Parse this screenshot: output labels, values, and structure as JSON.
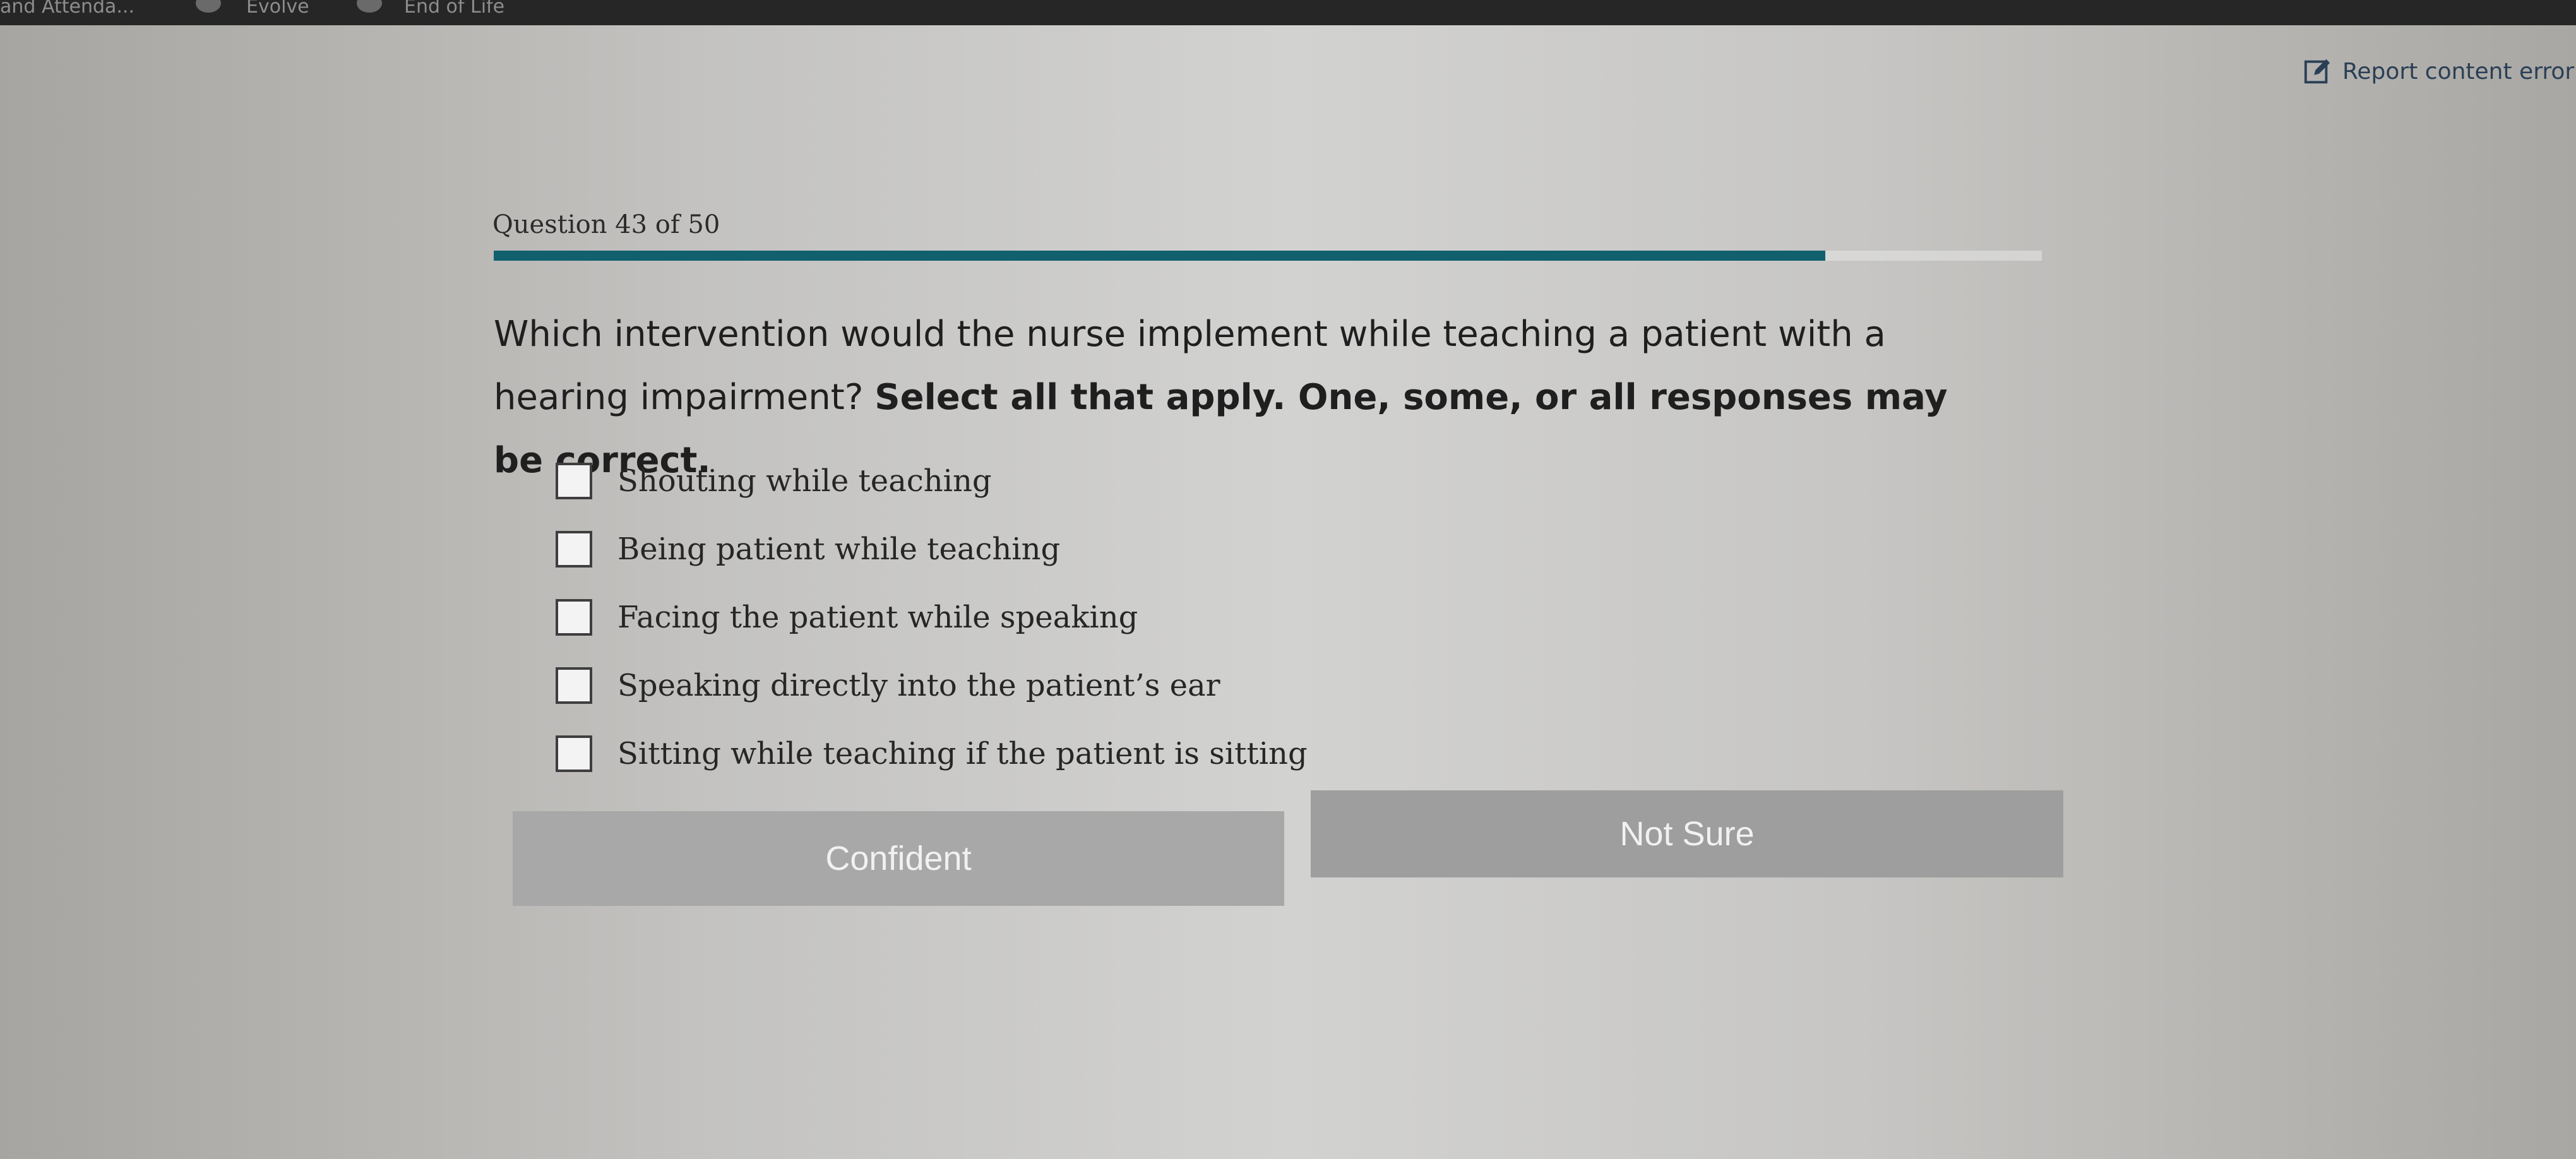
{
  "browser": {
    "tabs": [
      {
        "label": "and Attenda..."
      },
      {
        "label": "Evolve"
      },
      {
        "label": "End of Life"
      }
    ]
  },
  "header": {
    "report_label": "Report content error"
  },
  "quiz": {
    "question_counter": "Question 43 of 50",
    "progress": {
      "current": 43,
      "total": 50,
      "fraction": 0.86
    },
    "question_text": "Which intervention would the nurse implement while teaching a patient with a hearing impairment?",
    "instructions": "Select all that apply. One, some, or all responses may be correct.",
    "options": [
      {
        "label": "Shouting while teaching",
        "checked": false
      },
      {
        "label": "Being patient while teaching",
        "checked": false
      },
      {
        "label": "Facing the patient while speaking",
        "checked": false
      },
      {
        "label": "Speaking directly into the patient’s ear",
        "checked": false
      },
      {
        "label": "Sitting while teaching if the patient is sitting",
        "checked": false
      }
    ]
  },
  "buttons": {
    "confident_label": "Confident",
    "not_sure_label": "Not Sure"
  },
  "colors": {
    "progress_fill": "#12606e",
    "link": "#2a3f56",
    "button_bg": "#a8a8a8"
  },
  "icons": {
    "report": "edit-icon",
    "browser_tab": "evolve-icon"
  }
}
